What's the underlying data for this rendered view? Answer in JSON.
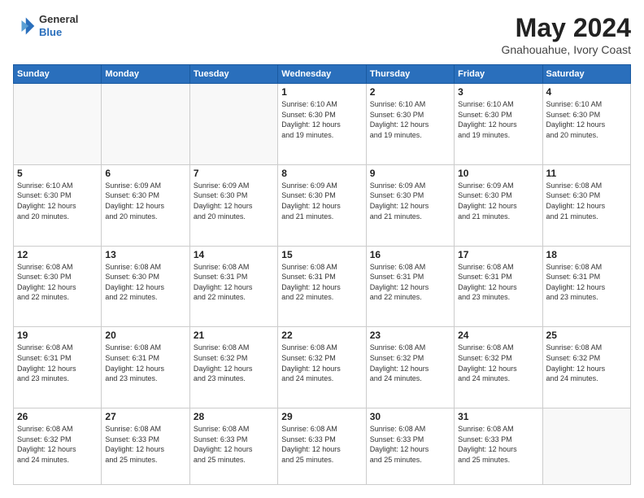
{
  "logo": {
    "general": "General",
    "blue": "Blue"
  },
  "header": {
    "month_year": "May 2024",
    "location": "Gnahouahue, Ivory Coast"
  },
  "weekdays": [
    "Sunday",
    "Monday",
    "Tuesday",
    "Wednesday",
    "Thursday",
    "Friday",
    "Saturday"
  ],
  "weeks": [
    {
      "days": [
        {
          "num": "",
          "info": ""
        },
        {
          "num": "",
          "info": ""
        },
        {
          "num": "",
          "info": ""
        },
        {
          "num": "1",
          "info": "Sunrise: 6:10 AM\nSunset: 6:30 PM\nDaylight: 12 hours\nand 19 minutes."
        },
        {
          "num": "2",
          "info": "Sunrise: 6:10 AM\nSunset: 6:30 PM\nDaylight: 12 hours\nand 19 minutes."
        },
        {
          "num": "3",
          "info": "Sunrise: 6:10 AM\nSunset: 6:30 PM\nDaylight: 12 hours\nand 19 minutes."
        },
        {
          "num": "4",
          "info": "Sunrise: 6:10 AM\nSunset: 6:30 PM\nDaylight: 12 hours\nand 20 minutes."
        }
      ]
    },
    {
      "days": [
        {
          "num": "5",
          "info": "Sunrise: 6:10 AM\nSunset: 6:30 PM\nDaylight: 12 hours\nand 20 minutes."
        },
        {
          "num": "6",
          "info": "Sunrise: 6:09 AM\nSunset: 6:30 PM\nDaylight: 12 hours\nand 20 minutes."
        },
        {
          "num": "7",
          "info": "Sunrise: 6:09 AM\nSunset: 6:30 PM\nDaylight: 12 hours\nand 20 minutes."
        },
        {
          "num": "8",
          "info": "Sunrise: 6:09 AM\nSunset: 6:30 PM\nDaylight: 12 hours\nand 21 minutes."
        },
        {
          "num": "9",
          "info": "Sunrise: 6:09 AM\nSunset: 6:30 PM\nDaylight: 12 hours\nand 21 minutes."
        },
        {
          "num": "10",
          "info": "Sunrise: 6:09 AM\nSunset: 6:30 PM\nDaylight: 12 hours\nand 21 minutes."
        },
        {
          "num": "11",
          "info": "Sunrise: 6:08 AM\nSunset: 6:30 PM\nDaylight: 12 hours\nand 21 minutes."
        }
      ]
    },
    {
      "days": [
        {
          "num": "12",
          "info": "Sunrise: 6:08 AM\nSunset: 6:30 PM\nDaylight: 12 hours\nand 22 minutes."
        },
        {
          "num": "13",
          "info": "Sunrise: 6:08 AM\nSunset: 6:30 PM\nDaylight: 12 hours\nand 22 minutes."
        },
        {
          "num": "14",
          "info": "Sunrise: 6:08 AM\nSunset: 6:31 PM\nDaylight: 12 hours\nand 22 minutes."
        },
        {
          "num": "15",
          "info": "Sunrise: 6:08 AM\nSunset: 6:31 PM\nDaylight: 12 hours\nand 22 minutes."
        },
        {
          "num": "16",
          "info": "Sunrise: 6:08 AM\nSunset: 6:31 PM\nDaylight: 12 hours\nand 22 minutes."
        },
        {
          "num": "17",
          "info": "Sunrise: 6:08 AM\nSunset: 6:31 PM\nDaylight: 12 hours\nand 23 minutes."
        },
        {
          "num": "18",
          "info": "Sunrise: 6:08 AM\nSunset: 6:31 PM\nDaylight: 12 hours\nand 23 minutes."
        }
      ]
    },
    {
      "days": [
        {
          "num": "19",
          "info": "Sunrise: 6:08 AM\nSunset: 6:31 PM\nDaylight: 12 hours\nand 23 minutes."
        },
        {
          "num": "20",
          "info": "Sunrise: 6:08 AM\nSunset: 6:31 PM\nDaylight: 12 hours\nand 23 minutes."
        },
        {
          "num": "21",
          "info": "Sunrise: 6:08 AM\nSunset: 6:32 PM\nDaylight: 12 hours\nand 23 minutes."
        },
        {
          "num": "22",
          "info": "Sunrise: 6:08 AM\nSunset: 6:32 PM\nDaylight: 12 hours\nand 24 minutes."
        },
        {
          "num": "23",
          "info": "Sunrise: 6:08 AM\nSunset: 6:32 PM\nDaylight: 12 hours\nand 24 minutes."
        },
        {
          "num": "24",
          "info": "Sunrise: 6:08 AM\nSunset: 6:32 PM\nDaylight: 12 hours\nand 24 minutes."
        },
        {
          "num": "25",
          "info": "Sunrise: 6:08 AM\nSunset: 6:32 PM\nDaylight: 12 hours\nand 24 minutes."
        }
      ]
    },
    {
      "days": [
        {
          "num": "26",
          "info": "Sunrise: 6:08 AM\nSunset: 6:32 PM\nDaylight: 12 hours\nand 24 minutes."
        },
        {
          "num": "27",
          "info": "Sunrise: 6:08 AM\nSunset: 6:33 PM\nDaylight: 12 hours\nand 25 minutes."
        },
        {
          "num": "28",
          "info": "Sunrise: 6:08 AM\nSunset: 6:33 PM\nDaylight: 12 hours\nand 25 minutes."
        },
        {
          "num": "29",
          "info": "Sunrise: 6:08 AM\nSunset: 6:33 PM\nDaylight: 12 hours\nand 25 minutes."
        },
        {
          "num": "30",
          "info": "Sunrise: 6:08 AM\nSunset: 6:33 PM\nDaylight: 12 hours\nand 25 minutes."
        },
        {
          "num": "31",
          "info": "Sunrise: 6:08 AM\nSunset: 6:33 PM\nDaylight: 12 hours\nand 25 minutes."
        },
        {
          "num": "",
          "info": ""
        }
      ]
    }
  ]
}
